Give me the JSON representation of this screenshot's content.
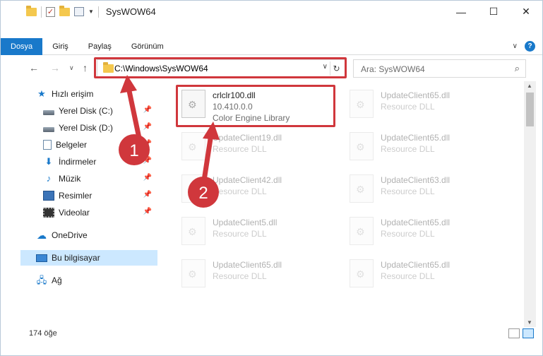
{
  "window": {
    "title": "SysWOW64",
    "controls": {
      "minimize": "—",
      "maximize": "☐",
      "close": "✕"
    }
  },
  "ribbon": {
    "tabs": [
      "Dosya",
      "Giriş",
      "Paylaş",
      "Görünüm"
    ],
    "help": "?"
  },
  "address": {
    "path": "C:\\Windows\\SysWOW64",
    "search_placeholder": "Ara: SysWOW64"
  },
  "sidebar": {
    "items": [
      {
        "label": "Hızlı erişim",
        "icon": "star-icon"
      },
      {
        "label": "Yerel Disk (C:)",
        "icon": "disk-icon",
        "pinned": true
      },
      {
        "label": "Yerel Disk (D:)",
        "icon": "disk-icon",
        "pinned": true
      },
      {
        "label": "Belgeler",
        "icon": "documents-icon",
        "pinned": true
      },
      {
        "label": "İndirmeler",
        "icon": "download-icon",
        "pinned": true
      },
      {
        "label": "Müzik",
        "icon": "music-icon",
        "pinned": true
      },
      {
        "label": "Resimler",
        "icon": "pictures-icon",
        "pinned": true
      },
      {
        "label": "Videolar",
        "icon": "videos-icon",
        "pinned": true
      },
      {
        "label": "OneDrive",
        "icon": "cloud-icon"
      },
      {
        "label": "Bu bilgisayar",
        "icon": "computer-icon",
        "selected": true
      },
      {
        "label": "Ağ",
        "icon": "network-icon"
      }
    ]
  },
  "files": [
    {
      "name": "crlclr100.dll",
      "line2": "10.410.0.0",
      "line3": "Color Engine Library",
      "highlighted": true
    },
    {
      "name": "UpdateClient65.dll",
      "line2": "Resource DLL"
    },
    {
      "name": "UpdateClient19.dll",
      "line2": "Resource DLL"
    },
    {
      "name": "UpdateClient65.dll",
      "line2": "Resource DLL"
    },
    {
      "name": "UpdateClient42.dll",
      "line2": "Resource DLL"
    },
    {
      "name": "UpdateClient63.dll",
      "line2": "Resource DLL"
    },
    {
      "name": "UpdateClient5.dll",
      "line2": "Resource DLL"
    },
    {
      "name": "UpdateClient65.dll",
      "line2": "Resource DLL"
    },
    {
      "name": "UpdateClient65.dll",
      "line2": "Resource DLL"
    },
    {
      "name": "UpdateClient65.dll",
      "line2": "Resource DLL"
    }
  ],
  "status": {
    "count": "174 öğe"
  },
  "annotations": {
    "step1": "1",
    "step2": "2",
    "color": "#d0373c"
  }
}
